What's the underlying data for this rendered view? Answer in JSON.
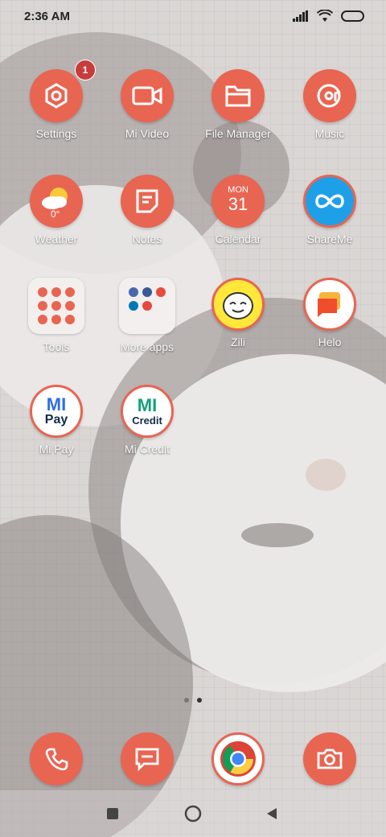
{
  "status": {
    "time": "2:36 AM"
  },
  "home": {
    "apps": [
      {
        "label": "Settings",
        "badge": "1"
      },
      {
        "label": "Mi Video"
      },
      {
        "label": "File Manager"
      },
      {
        "label": "Music"
      },
      {
        "label": "Weather",
        "temp": "0°"
      },
      {
        "label": "Notes"
      },
      {
        "label": "Calendar",
        "day": "MON",
        "date": "31"
      },
      {
        "label": "ShareMe"
      },
      {
        "label": "Tools"
      },
      {
        "label": "More apps"
      },
      {
        "label": "Zili"
      },
      {
        "label": "Helo"
      },
      {
        "label": "Mi Pay",
        "text_top": "MI",
        "text_bottom": "Pay"
      },
      {
        "label": "Mi Credit",
        "text_top": "MI",
        "text_bottom": "Credit"
      }
    ],
    "page_indicator": {
      "pages": 2,
      "current": 2
    }
  },
  "dock": [
    "Phone",
    "Messaging",
    "Chrome",
    "Camera"
  ],
  "colors": {
    "accent": "#e86552",
    "badge": "#c93c3c"
  }
}
